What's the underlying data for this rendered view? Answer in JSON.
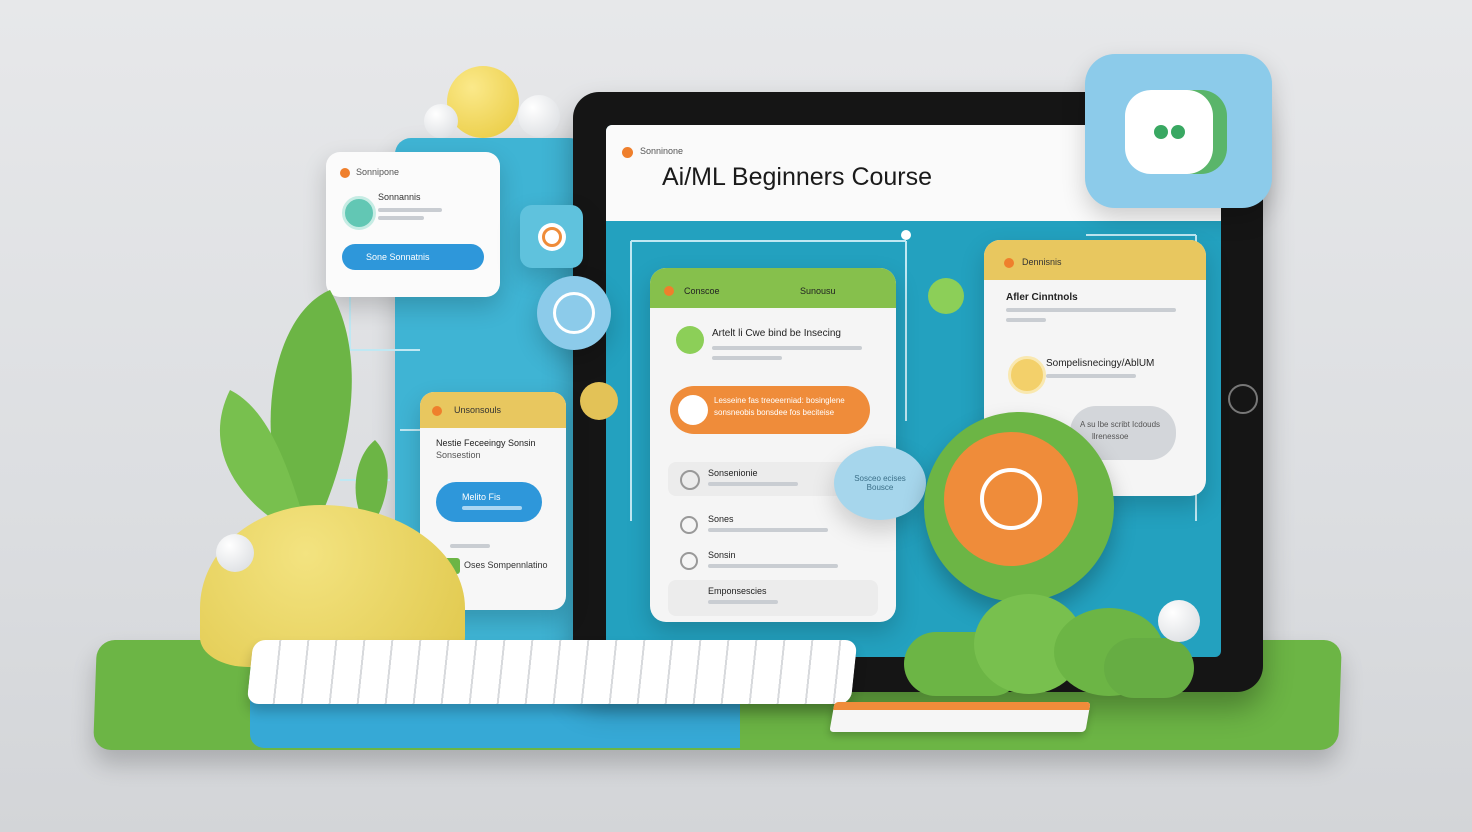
{
  "screen": {
    "header_label": "Sonninone",
    "title": "Ai/ML Beginners Course"
  },
  "left_card": {
    "header": "Sonnipone",
    "item_title": "Sonnannis",
    "button": "Sone Sonnatnis"
  },
  "small_card": {
    "header": "Unsonsouls",
    "title": "Nestie Feceeingy Sonsin",
    "subtitle": "Sonsestion",
    "pill": "Melito Fis",
    "footer": "Oses Sompennlatino"
  },
  "main_card": {
    "header": "Conscoe",
    "header_right": "Sunousu",
    "item_title": "Artelt li Cwe bind be Insecing",
    "cta_line1": "Lesseine fas treoeerniad: bosinglene",
    "cta_line2": "sonsneobis bonsdee fos beciteise",
    "list": [
      {
        "label": "Sonsenionie"
      },
      {
        "label": "Sones"
      },
      {
        "label": "Sonsin"
      },
      {
        "label": "Emponsescies"
      }
    ]
  },
  "right_card": {
    "header": "Dennisnis",
    "title": "Afler Cinntnols",
    "item_title": "Sompelisnecingy/AblUM",
    "gray_line1": "A su lbe scribt Icdouds",
    "gray_line2": "llrenessoe"
  },
  "bubble": {
    "text": "Sosceo ecises Bousce"
  },
  "colors": {
    "teal": "#1fa3bf",
    "blue": "#2b9ad8",
    "green": "#7cbf4c",
    "orange": "#ef8c3a",
    "yellow": "#e7c75a",
    "sky": "#9fd4ee"
  }
}
